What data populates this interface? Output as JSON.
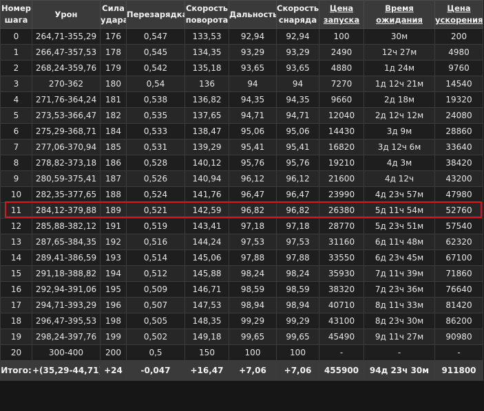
{
  "headers": [
    {
      "label": "Номер шага",
      "link": false
    },
    {
      "label": "Урон",
      "link": false
    },
    {
      "label": "Сила удара",
      "link": false
    },
    {
      "label": "Перезарядка",
      "link": false
    },
    {
      "label": "Скорость поворота",
      "link": false
    },
    {
      "label": "Дальность",
      "link": false
    },
    {
      "label": "Скорость снаряда",
      "link": false
    },
    {
      "label": "Цена запуска",
      "link": true
    },
    {
      "label": "Время ожидания",
      "link": true
    },
    {
      "label": "Цена ускорения",
      "link": true
    }
  ],
  "rows": [
    [
      "0",
      "264,71-355,29",
      "176",
      "0,547",
      "133,53",
      "92,94",
      "92,94",
      "100",
      "30м",
      "200"
    ],
    [
      "1",
      "266,47-357,53",
      "178",
      "0,545",
      "134,35",
      "93,29",
      "93,29",
      "2490",
      "12ч 27м",
      "4980"
    ],
    [
      "2",
      "268,24-359,76",
      "179",
      "0,542",
      "135,18",
      "93,65",
      "93,65",
      "4880",
      "1д 24м",
      "9760"
    ],
    [
      "3",
      "270-362",
      "180",
      "0,54",
      "136",
      "94",
      "94",
      "7270",
      "1д 12ч 21м",
      "14540"
    ],
    [
      "4",
      "271,76-364,24",
      "181",
      "0,538",
      "136,82",
      "94,35",
      "94,35",
      "9660",
      "2д 18м",
      "19320"
    ],
    [
      "5",
      "273,53-366,47",
      "182",
      "0,535",
      "137,65",
      "94,71",
      "94,71",
      "12040",
      "2д 12ч 12м",
      "24080"
    ],
    [
      "6",
      "275,29-368,71",
      "184",
      "0,533",
      "138,47",
      "95,06",
      "95,06",
      "14430",
      "3д 9м",
      "28860"
    ],
    [
      "7",
      "277,06-370,94",
      "185",
      "0,531",
      "139,29",
      "95,41",
      "95,41",
      "16820",
      "3д 12ч 6м",
      "33640"
    ],
    [
      "8",
      "278,82-373,18",
      "186",
      "0,528",
      "140,12",
      "95,76",
      "95,76",
      "19210",
      "4д 3м",
      "38420"
    ],
    [
      "9",
      "280,59-375,41",
      "187",
      "0,526",
      "140,94",
      "96,12",
      "96,12",
      "21600",
      "4д 12ч",
      "43200"
    ],
    [
      "10",
      "282,35-377,65",
      "188",
      "0,524",
      "141,76",
      "96,47",
      "96,47",
      "23990",
      "4д 23ч 57м",
      "47980"
    ],
    [
      "11",
      "284,12-379,88",
      "189",
      "0,521",
      "142,59",
      "96,82",
      "96,82",
      "26380",
      "5д 11ч 54м",
      "52760"
    ],
    [
      "12",
      "285,88-382,12",
      "191",
      "0,519",
      "143,41",
      "97,18",
      "97,18",
      "28770",
      "5д 23ч 51м",
      "57540"
    ],
    [
      "13",
      "287,65-384,35",
      "192",
      "0,516",
      "144,24",
      "97,53",
      "97,53",
      "31160",
      "6д 11ч 48м",
      "62320"
    ],
    [
      "14",
      "289,41-386,59",
      "193",
      "0,514",
      "145,06",
      "97,88",
      "97,88",
      "33550",
      "6д 23ч 45м",
      "67100"
    ],
    [
      "15",
      "291,18-388,82",
      "194",
      "0,512",
      "145,88",
      "98,24",
      "98,24",
      "35930",
      "7д 11ч 39м",
      "71860"
    ],
    [
      "16",
      "292,94-391,06",
      "195",
      "0,509",
      "146,71",
      "98,59",
      "98,59",
      "38320",
      "7д 23ч 36м",
      "76640"
    ],
    [
      "17",
      "294,71-393,29",
      "196",
      "0,507",
      "147,53",
      "98,94",
      "98,94",
      "40710",
      "8д 11ч 33м",
      "81420"
    ],
    [
      "18",
      "296,47-395,53",
      "198",
      "0,505",
      "148,35",
      "99,29",
      "99,29",
      "43100",
      "8д 23ч 30м",
      "86200"
    ],
    [
      "19",
      "298,24-397,76",
      "199",
      "0,502",
      "149,18",
      "99,65",
      "99,65",
      "45490",
      "9д 11ч 27м",
      "90980"
    ],
    [
      "20",
      "300-400",
      "200",
      "0,5",
      "150",
      "100",
      "100",
      "-",
      "-",
      "-"
    ]
  ],
  "total": [
    "Итого:",
    "+(35,29-44,71)",
    "+24",
    "-0,047",
    "+16,47",
    "+7,06",
    "+7,06",
    "455900",
    "94д 23ч 30м",
    "911800"
  ],
  "highlight": {
    "row_label": "10",
    "color": "#e0141e"
  }
}
